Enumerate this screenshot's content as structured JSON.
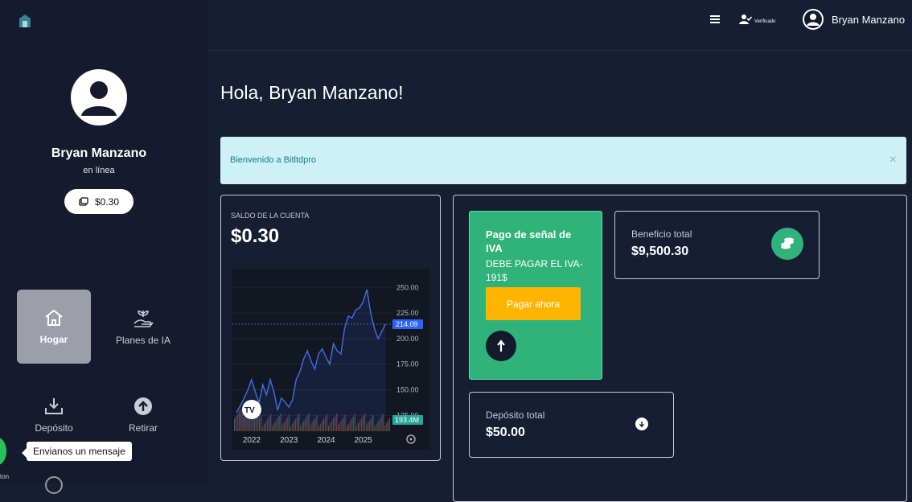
{
  "header": {
    "verified_label": "Verificado",
    "username": "Bryan Manzano"
  },
  "sidebar": {
    "user_name": "Bryan Manzano",
    "status": "en línea",
    "balance": "$0.30",
    "nav": [
      {
        "label": "Hogar",
        "icon": "home-icon"
      },
      {
        "label": "Planes de IA",
        "icon": "plant-hand-icon"
      },
      {
        "label": "Depósito",
        "icon": "download-tray-icon"
      },
      {
        "label": "Retirar",
        "icon": "upload-circle-icon"
      }
    ],
    "chat_tooltip": "Envianos un mensaje",
    "chat_sublabel": "ton"
  },
  "main": {
    "greeting": "Hola, Bryan Manzano!",
    "alert": {
      "text": "Bienvenido a Bitltdpro",
      "close": "×"
    },
    "balance_card": {
      "label": "SALDO DE LA CUENTA",
      "value": "$0.30"
    },
    "tax_card": {
      "title": "Pago de señal de IVA",
      "description": "DEBE PAGAR EL IVA-191$",
      "button": "Pagar ahora"
    },
    "profit_card": {
      "label": "Beneficio total",
      "value": "$9,500.30"
    },
    "deposit_card": {
      "label": "Depósito total",
      "value": "$50.00"
    }
  },
  "chart_data": {
    "type": "line",
    "x_ticks": [
      "2022",
      "2023",
      "2024",
      "2025"
    ],
    "y_ticks": [
      250.0,
      225.0,
      200.0,
      175.0,
      150.0,
      125.0
    ],
    "ylim": [
      115,
      262
    ],
    "last_price": 214.09,
    "last_price_label": "214.09",
    "volume_label": "193.4M",
    "x": [
      2021.6,
      2021.75,
      2021.9,
      2022.0,
      2022.1,
      2022.2,
      2022.3,
      2022.4,
      2022.5,
      2022.6,
      2022.7,
      2022.8,
      2022.9,
      2023.0,
      2023.1,
      2023.2,
      2023.3,
      2023.4,
      2023.5,
      2023.6,
      2023.7,
      2023.8,
      2023.9,
      2024.0,
      2024.1,
      2024.2,
      2024.3,
      2024.4,
      2024.5,
      2024.6,
      2024.7,
      2024.8,
      2024.9,
      2025.0,
      2025.1,
      2025.2,
      2025.3,
      2025.4,
      2025.5,
      2025.6
    ],
    "y": [
      128,
      138,
      150,
      160,
      148,
      137,
      155,
      145,
      160,
      148,
      130,
      142,
      138,
      133,
      140,
      160,
      168,
      180,
      188,
      178,
      170,
      185,
      190,
      182,
      175,
      195,
      188,
      185,
      210,
      222,
      220,
      228,
      230,
      236,
      248,
      225,
      210,
      200,
      207,
      214
    ]
  }
}
